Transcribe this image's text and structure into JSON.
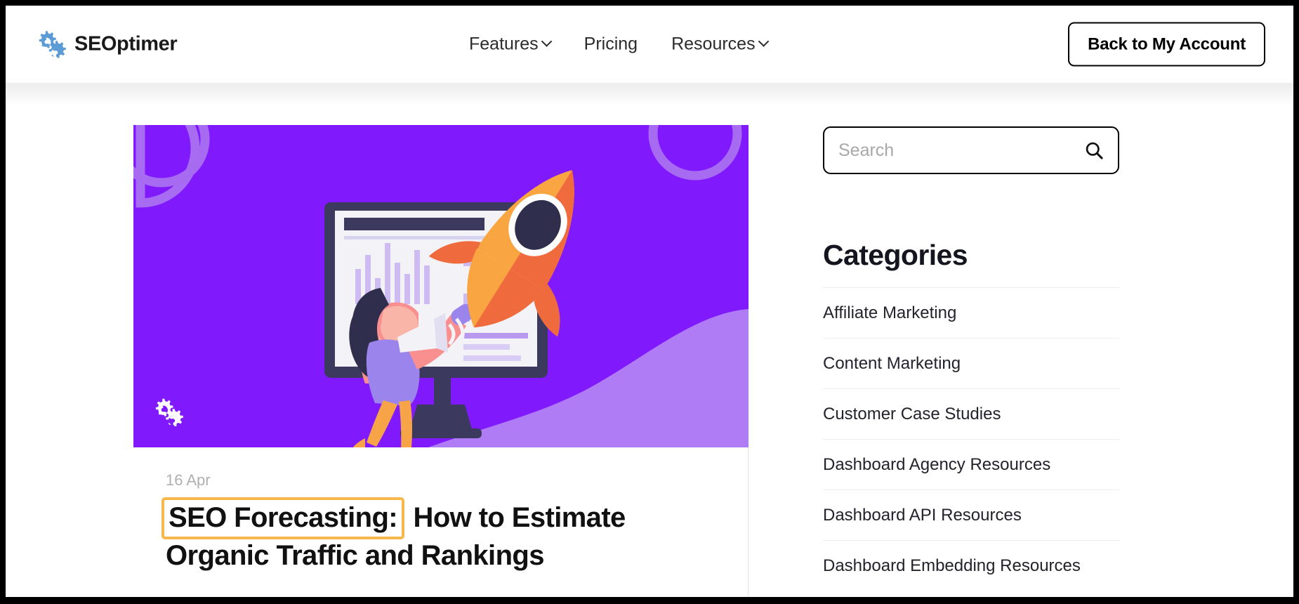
{
  "header": {
    "logo_text": "SEOptimer",
    "logo_icon": "gears-logo-icon",
    "nav": [
      {
        "label": "Features",
        "has_dropdown": true,
        "icon": "chevron-down-icon"
      },
      {
        "label": "Pricing",
        "has_dropdown": false
      },
      {
        "label": "Resources",
        "has_dropdown": true,
        "icon": "chevron-down-icon"
      }
    ],
    "account_button_label": "Back to My Account"
  },
  "article": {
    "date": "16 Apr",
    "title_highlight": "SEO Forecasting:",
    "title_rest": "How to Estimate Organic Traffic and Rankings",
    "hero_logo_icon": "gears-logo-icon",
    "hero_alt": "rocket-and-monitor-illustration"
  },
  "sidebar": {
    "search": {
      "placeholder": "Search",
      "value": "",
      "icon": "search-icon"
    },
    "categories_title": "Categories",
    "categories": [
      "Affiliate Marketing",
      "Content Marketing",
      "Customer Case Studies",
      "Dashboard Agency Resources",
      "Dashboard API Resources",
      "Dashboard Embedding Resources"
    ]
  },
  "colors": {
    "brand_blue": "#5b9bd5",
    "hero_purple": "#8019fb",
    "hero_purple_light": "#b07cf5",
    "highlight_orange": "#f7b84b",
    "text_dark": "#15151f",
    "muted_grey": "#b0b0b0",
    "divider": "#ececec",
    "frame_black": "#000000"
  }
}
